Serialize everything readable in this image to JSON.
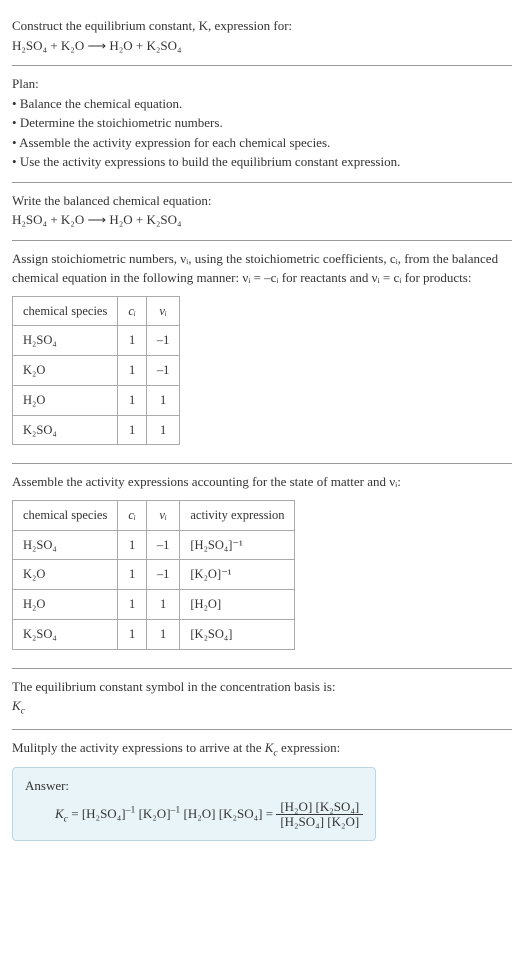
{
  "header": {
    "prompt_line1": "Construct the equilibrium constant, K, expression for:",
    "equation": "H₂SO₄ + K₂O ⟶ H₂O + K₂SO₄"
  },
  "plan": {
    "title": "Plan:",
    "items": [
      "Balance the chemical equation.",
      "Determine the stoichiometric numbers.",
      "Assemble the activity expression for each chemical species.",
      "Use the activity expressions to build the equilibrium constant expression."
    ]
  },
  "balanced": {
    "intro": "Write the balanced chemical equation:",
    "equation": "H₂SO₄ + K₂O ⟶ H₂O + K₂SO₄"
  },
  "stoich": {
    "intro": "Assign stoichiometric numbers, νᵢ, using the stoichiometric coefficients, cᵢ, from the balanced chemical equation in the following manner: νᵢ = –cᵢ for reactants and νᵢ = cᵢ for products:",
    "headers": {
      "species": "chemical species",
      "ci": "cᵢ",
      "vi": "νᵢ"
    },
    "rows": [
      {
        "species": "H₂SO₄",
        "ci": "1",
        "vi": "–1"
      },
      {
        "species": "K₂O",
        "ci": "1",
        "vi": "–1"
      },
      {
        "species": "H₂O",
        "ci": "1",
        "vi": "1"
      },
      {
        "species": "K₂SO₄",
        "ci": "1",
        "vi": "1"
      }
    ]
  },
  "activity": {
    "intro": "Assemble the activity expressions accounting for the state of matter and νᵢ:",
    "headers": {
      "species": "chemical species",
      "ci": "cᵢ",
      "vi": "νᵢ",
      "expr": "activity expression"
    },
    "rows": [
      {
        "species": "H₂SO₄",
        "ci": "1",
        "vi": "–1",
        "expr": "[H₂SO₄]⁻¹"
      },
      {
        "species": "K₂O",
        "ci": "1",
        "vi": "–1",
        "expr": "[K₂O]⁻¹"
      },
      {
        "species": "H₂O",
        "ci": "1",
        "vi": "1",
        "expr": "[H₂O]"
      },
      {
        "species": "K₂SO₄",
        "ci": "1",
        "vi": "1",
        "expr": "[K₂SO₄]"
      }
    ]
  },
  "symbol": {
    "intro": "The equilibrium constant symbol in the concentration basis is:",
    "value": "K_c"
  },
  "multiply": {
    "intro": "Mulitply the activity expressions to arrive at the K_c expression:"
  },
  "answer": {
    "label": "Answer:",
    "lhs": "K_c = [H₂SO₄]⁻¹ [K₂O]⁻¹ [H₂O] [K₂SO₄] =",
    "frac_num": "[H₂O] [K₂SO₄]",
    "frac_den": "[H₂SO₄] [K₂O]"
  }
}
